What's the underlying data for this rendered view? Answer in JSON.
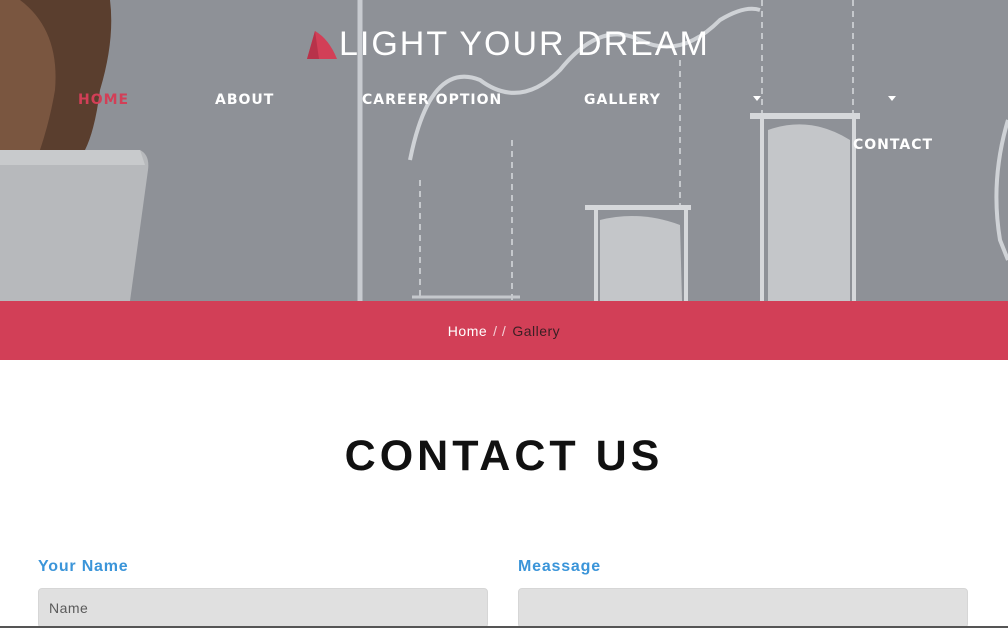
{
  "brand": {
    "title": "LIGHT YOUR DREAM",
    "logo_icon": "sail-logo-icon",
    "accent": "#d23f57"
  },
  "nav": {
    "home": "HOME",
    "about": "ABOUT",
    "career": "CAREER OPTION",
    "gallery": "GALLERY",
    "contact": "CONTACT"
  },
  "breadcrumb": {
    "home": "Home",
    "separator": "/ /",
    "current": "Gallery"
  },
  "section": {
    "title": "CONTACT US"
  },
  "form": {
    "name_label": "Your Name",
    "name_placeholder": "Name",
    "message_label": "Meassage",
    "label_color": "#3b95d9"
  }
}
